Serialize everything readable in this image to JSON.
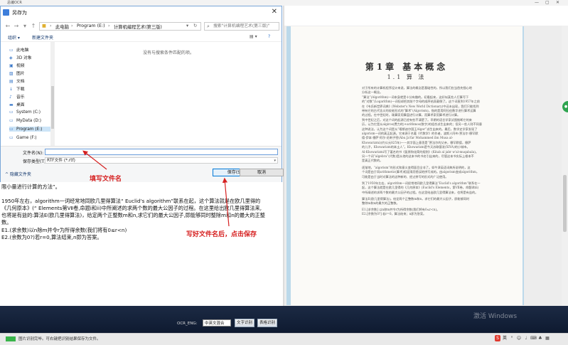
{
  "app": {
    "title": "总编OCR"
  },
  "dialog": {
    "title": "另存为",
    "breadcrumb": [
      "此电脑",
      "Program (E:)",
      "计算机编程艺术(第三版)"
    ],
    "search_placeholder": "搜索\"计算机编程艺术(第三版)\"",
    "organize": "组织 ▾",
    "new_folder": "新建文件夹",
    "empty_message": "没有与搜索条件匹配的项。",
    "nav_items": [
      {
        "label": "此电脑",
        "icon": "computer-icon"
      },
      {
        "label": "3D 对象",
        "icon": "cube-icon"
      },
      {
        "label": "视频",
        "icon": "video-icon"
      },
      {
        "label": "图片",
        "icon": "picture-icon"
      },
      {
        "label": "文档",
        "icon": "document-icon"
      },
      {
        "label": "下载",
        "icon": "download-icon"
      },
      {
        "label": "音乐",
        "icon": "music-icon"
      },
      {
        "label": "桌面",
        "icon": "desktop-icon"
      },
      {
        "label": "System (C:)",
        "icon": "drive-icon"
      },
      {
        "label": "MyData (D:)",
        "icon": "drive-icon"
      },
      {
        "label": "Program (E:)",
        "icon": "drive-icon"
      },
      {
        "label": "Game (F:)",
        "icon": "drive-icon"
      }
    ],
    "filename_label": "文件名(N):",
    "filename_value": "",
    "filetype_label": "保存类型(T):",
    "filetype_value": "RTF文件 (*.rtf)",
    "hide_folders": "^ 隐藏文件夹",
    "save_button": "保存(S)",
    "cancel_button": "取消"
  },
  "annotations": {
    "fill_filename": "填写文件名",
    "after_click_save": "写好文件名后，点击保存"
  },
  "editor": {
    "lines": [
      "限小量进行计算的方法”。",
      "",
      "1950年左右，algorithm一词经常地同欧几里得算法“ Euclid's algorithm”联系在起，这个算法就是在欧几里得的",
      "《几何原本》(“ Elements第VⅡ卷,命题i和ii)中所阐述的求两个数的最大公因子的过程。在这里给出欧几里得算法来,",
      "也将是有益的:算法E(欧几里得算法)，给定两个正整数m和n,求它们的最大公因子,即能够同时整除m和n的最大的正整",
      "数。",
      "E1.(求余数)以n除m并令r为所得余数(我们将有0≤r<n)",
      "E2.(余数为0?)若r=0,算法结束,n即为答案。"
    ]
  },
  "document": {
    "chapter": "第1章  基本概念",
    "section": "1.1  算  法",
    "lines": [
      "对于所有的计算机程序设计来说，算法的概念是基础性的，所以我们应当首先细心地",
      "分析这一概念。",
      "“算法”(Algorithm)一词本身就是十分有趣的。初看起来，这好似某些人打算写下",
      "的“对数”(Logarithm)一词但却把其前个字母的顺序给弄颠倒了。这个词直到1957年之前",
      "在《韦氏新世界词典》(Webster's New World Dictionary)中还未出现，我们只能找到",
      "带有它的古代含义的较老形式的“算术”(Algorism)，指的是用阿拉伯数字进行算术运算",
      "的过程。在中世纪时，珠算家用算盘进行计算，而算术家用算术进行计算。",
      "到中世纪之后，对这个词的起源已经有些不清楚了。早期的语言学家试图推断它的来",
      "历，认为它是从algiros(费力的)+arithmos(数字)的组合派生出来的；但另一些人则不同意",
      "这种说法，认为这个词是从“喀斯迪尔国王Algor”派生出来的。最后，数学史学家发现了",
      "algorism一词的真正起源。它来源于名著《代数学》的作者，波斯人阿布·贾法尔·穆罕默",
      "德·伊本·穆萨·阿尔·花剌子密(Abu Ja'far Mohammed ibn Musa al-",
      "Khowarizmi)(约公元825年)——其字面上意思是“贾法尔的父亲，穆罕默德，穆萨",
      "的儿子，Khowarizm的本土人”。Khowarizm是今天苏联基发(XIVA)的小城市。",
      "Al-Khowarizmi写了著名的书《复原和化简的规则》(Kitab al jabr w'al-muqabala)。",
      "另一个词“algebra”(代数)是从他的这本书的书名引出来的，尽管这本书实际上根本不",
      "是真正代数的。",
      "逐渐地，“algorism”的形式和意义变得面目全非了。如牛津英语词典所说明的，这",
      "个词是由于同arithmetic(算术)相混淆而错误地拼写成的。由algorism变成algorithm，",
      "可能是由于当时对算法的这种新的、经过拼写的形式的广泛使用。",
      "到了1950年左右，algorithm一词经常地同欧几里得算法“Euclid's algorithm”联系在一",
      "起，这个算法就是在欧几里得的《几何原本》(Euclid's Elements，第VⅡ卷，命题i和ii)",
      "中所阐述的求两个数的最大公因子的过程。在这里给出欧几里得算法来，也将是有益的。",
      "算法E(欧几里得算法)。给定两个正整数m和n，求它们的最大公因子，即能够同时",
      "整除m和n的最大的正整数。",
      "E1.[求余数] 以n除m并令r为所得余数(我们将有0≤r<n)。",
      "E2.[余数为0?] 若r=0，算法结束；n即为答案。"
    ]
  },
  "bottom": {
    "engine_label": "OCR_ENG:",
    "engine_value": "中英文混合",
    "text_recognize": "文字识别",
    "table_recognize": "表格识别",
    "watermark": "激活 Windows"
  },
  "status": {
    "message": "图片识别完毕。可右键把识别结果保存为文件。",
    "ime_label": "英"
  }
}
